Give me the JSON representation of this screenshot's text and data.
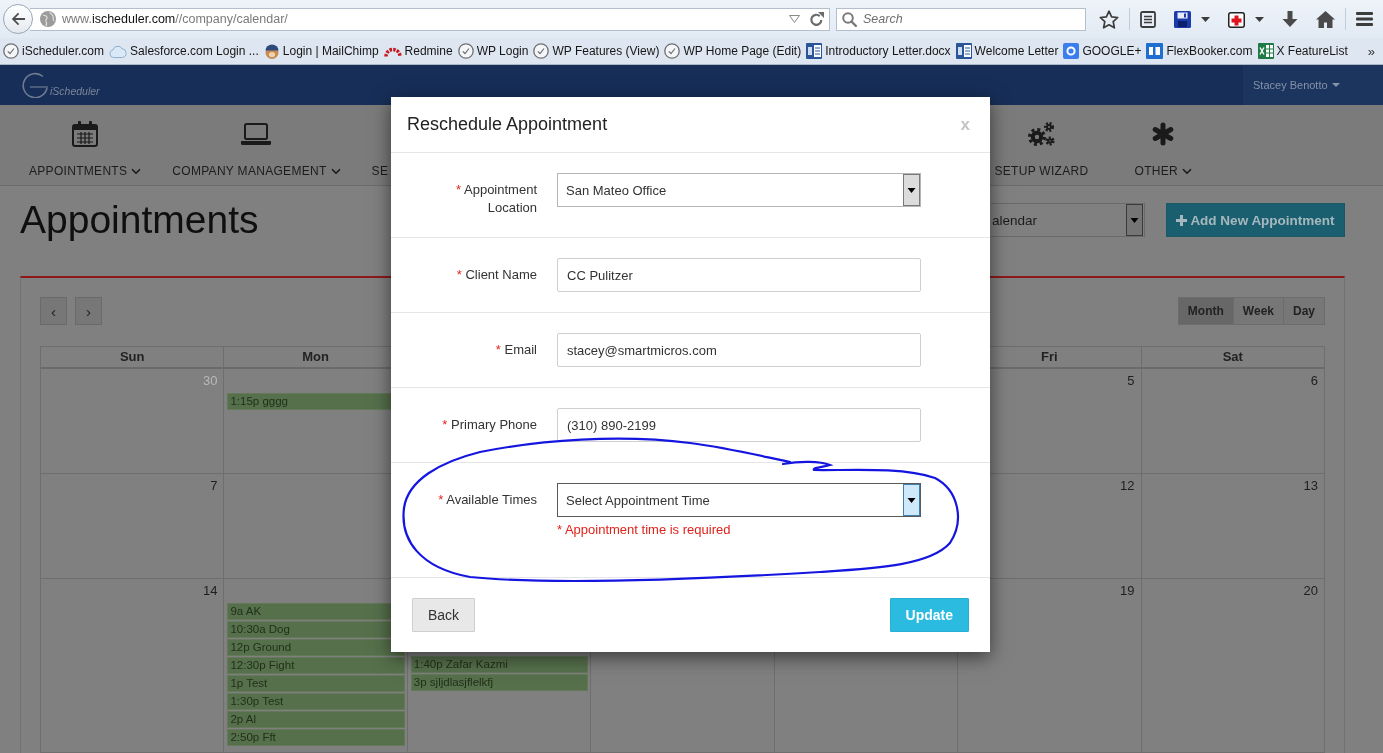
{
  "browser": {
    "url": {
      "prefix": "www.",
      "domain": "ischeduler.com",
      "path": "//company/calendar/"
    },
    "search": {
      "placeholder": "Search"
    },
    "bookmarks": [
      {
        "kind": "page",
        "label": "iScheduler.com"
      },
      {
        "kind": "cloud",
        "label": "Salesforce.com Login ..."
      },
      {
        "kind": "mascot",
        "label": "Login | MailChimp"
      },
      {
        "kind": "arc",
        "label": "Redmine"
      },
      {
        "kind": "page",
        "label": "WP Login"
      },
      {
        "kind": "page",
        "label": "WP Features (View)"
      },
      {
        "kind": "page",
        "label": "WP Home Page (Edit)"
      },
      {
        "kind": "word",
        "label": "Introductory Letter.docx"
      },
      {
        "kind": "word",
        "label": "Welcome Letter"
      },
      {
        "kind": "google",
        "label": "GOOGLE+"
      },
      {
        "kind": "tile",
        "label": "FlexBooker.com"
      },
      {
        "kind": "sheet",
        "label": "X FeatureList"
      }
    ],
    "overflow": "»"
  },
  "header": {
    "brand": "iScheduler",
    "user": "Stacey Benotto"
  },
  "nav": {
    "left": [
      {
        "kind": "calendar",
        "label": "APPOINTMENTS",
        "dropdown": true
      },
      {
        "kind": "laptop",
        "label": "COMPANY MANAGEMENT",
        "dropdown": true
      },
      {
        "label": "SE"
      }
    ],
    "right": [
      {
        "kind": "gears",
        "label": "SETUP WIZARD",
        "dropdown": false
      },
      {
        "kind": "asterisk",
        "label": "OTHER",
        "dropdown": true
      }
    ]
  },
  "page": {
    "title": "Appointments",
    "view_select": "alendar",
    "add_button": "Add New Appointment"
  },
  "calendar": {
    "prev": "‹",
    "next": "›",
    "views": [
      {
        "label": "Month",
        "selected": true
      },
      {
        "label": "Week",
        "selected": false
      },
      {
        "label": "Day",
        "selected": false
      }
    ],
    "weekdays": {
      "left": [
        "Sun",
        "Mon"
      ],
      "right": [
        "Fri",
        "Sat"
      ]
    },
    "weeks": [
      {
        "left": [
          {
            "number": "30",
            "other_month": true
          },
          {
            "events": [
              "1:15p gggg"
            ]
          }
        ],
        "right": [
          {
            "number": "5",
            "other_month": false
          },
          {
            "number": "6",
            "other_month": false
          }
        ]
      },
      {
        "left": [
          {
            "number": "7",
            "other_month": false
          }
        ],
        "right": [
          {
            "number": "12",
            "other_month": false
          },
          {
            "number": "13",
            "other_month": false
          }
        ]
      },
      {
        "left": [
          {
            "number": "14",
            "other_month": false
          },
          {
            "events": [
              "9a AK",
              "10:30a Dog",
              "12p Ground",
              "12:30p Fight",
              "1p Test",
              "1:30p Test",
              "2p Al",
              "2:50p Fft"
            ]
          },
          {
            "events": [
              "1:40p Zafar Kazmi",
              "3p sjljdlasjflelkfj"
            ]
          }
        ],
        "right": [
          {
            "number": "19",
            "other_month": false
          },
          {
            "number": "20",
            "other_month": false
          }
        ]
      }
    ]
  },
  "modal": {
    "title": "Reschedule Appointment",
    "close": "x",
    "fields": [
      {
        "kind": "select",
        "mark": "*",
        "label": "Appointment Location",
        "value": "San Mateo Office",
        "focused": false
      },
      {
        "kind": "text",
        "mark": "*",
        "label": "Client Name",
        "value": "CC Pulitzer"
      },
      {
        "kind": "text",
        "mark": "*",
        "label": "Email",
        "value": "stacey@smartmicros.com"
      },
      {
        "kind": "text",
        "mark": "*",
        "label": "Primary Phone",
        "value": "(310) 890-2199"
      },
      {
        "kind": "select",
        "mark": "*",
        "label": "Available Times",
        "value": "Select Appointment Time",
        "focused": true,
        "error": "* Appointment time is required"
      }
    ],
    "buttons": [
      {
        "kind": "secondary",
        "label": "Back"
      },
      {
        "kind": "primary",
        "label": "Update"
      }
    ]
  }
}
